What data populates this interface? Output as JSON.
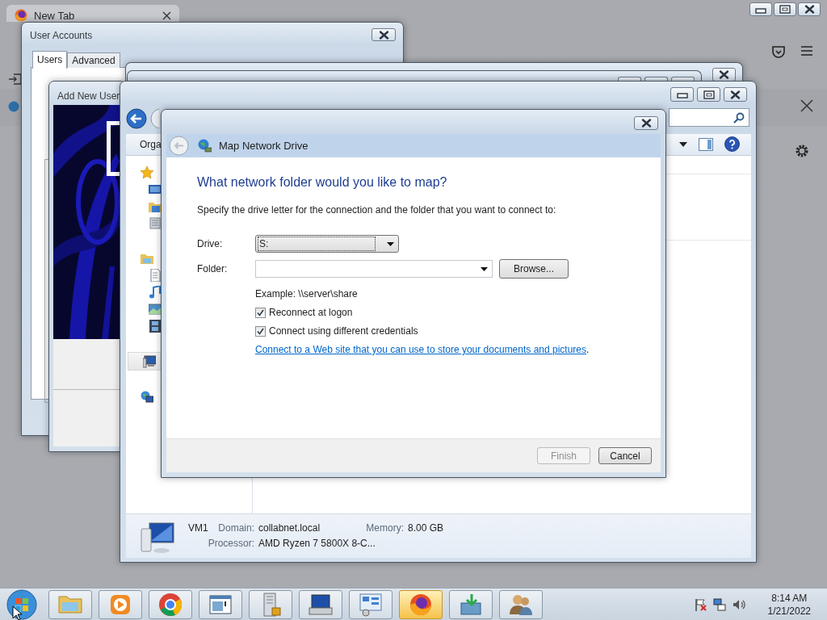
{
  "browser": {
    "tab_title": "New Tab"
  },
  "user_accounts": {
    "title": "User Accounts",
    "tabs": [
      {
        "label": "Users",
        "selected": true
      },
      {
        "label": "Advanced",
        "selected": false
      }
    ]
  },
  "add_user": {
    "title": "Add New User"
  },
  "explorer": {
    "toolbar_label": "Orga",
    "details": {
      "name": "VM1",
      "domain_label": "Domain:",
      "domain": "collabnet.local",
      "memory_label": "Memory:",
      "memory": "8.00 GB",
      "processor_label": "Processor:",
      "processor": "AMD Ryzen 7 5800X 8-C..."
    }
  },
  "dialog": {
    "title": "Map Network Drive",
    "heading": "What network folder would you like to map?",
    "instruction": "Specify the drive letter for the connection and the folder that you want to connect to:",
    "drive_label": "Drive:",
    "drive_value": "S:",
    "folder_label": "Folder:",
    "browse": "Browse...",
    "example": "Example: \\\\server\\share",
    "options": [
      {
        "label": "Reconnect at logon",
        "checked": true
      },
      {
        "label": "Connect using different credentials",
        "checked": true
      }
    ],
    "link": "Connect to a Web site that you can use to store your documents and pictures",
    "link_suffix": ".",
    "buttons": [
      {
        "label": "Finish",
        "disabled": true
      },
      {
        "label": "Cancel",
        "disabled": false
      }
    ]
  },
  "taskbar": {
    "apps": [
      {
        "kind": "folder",
        "active": false
      },
      {
        "kind": "media",
        "active": false
      },
      {
        "kind": "chrome",
        "active": false
      },
      {
        "kind": "window",
        "active": false
      },
      {
        "kind": "server",
        "active": false
      },
      {
        "kind": "computer",
        "active": false
      },
      {
        "kind": "panel",
        "active": false
      },
      {
        "kind": "firefox",
        "active": true
      },
      {
        "kind": "download",
        "active": false
      },
      {
        "kind": "users",
        "active": false
      }
    ],
    "time": "8:14 AM",
    "date": "1/21/2022"
  }
}
